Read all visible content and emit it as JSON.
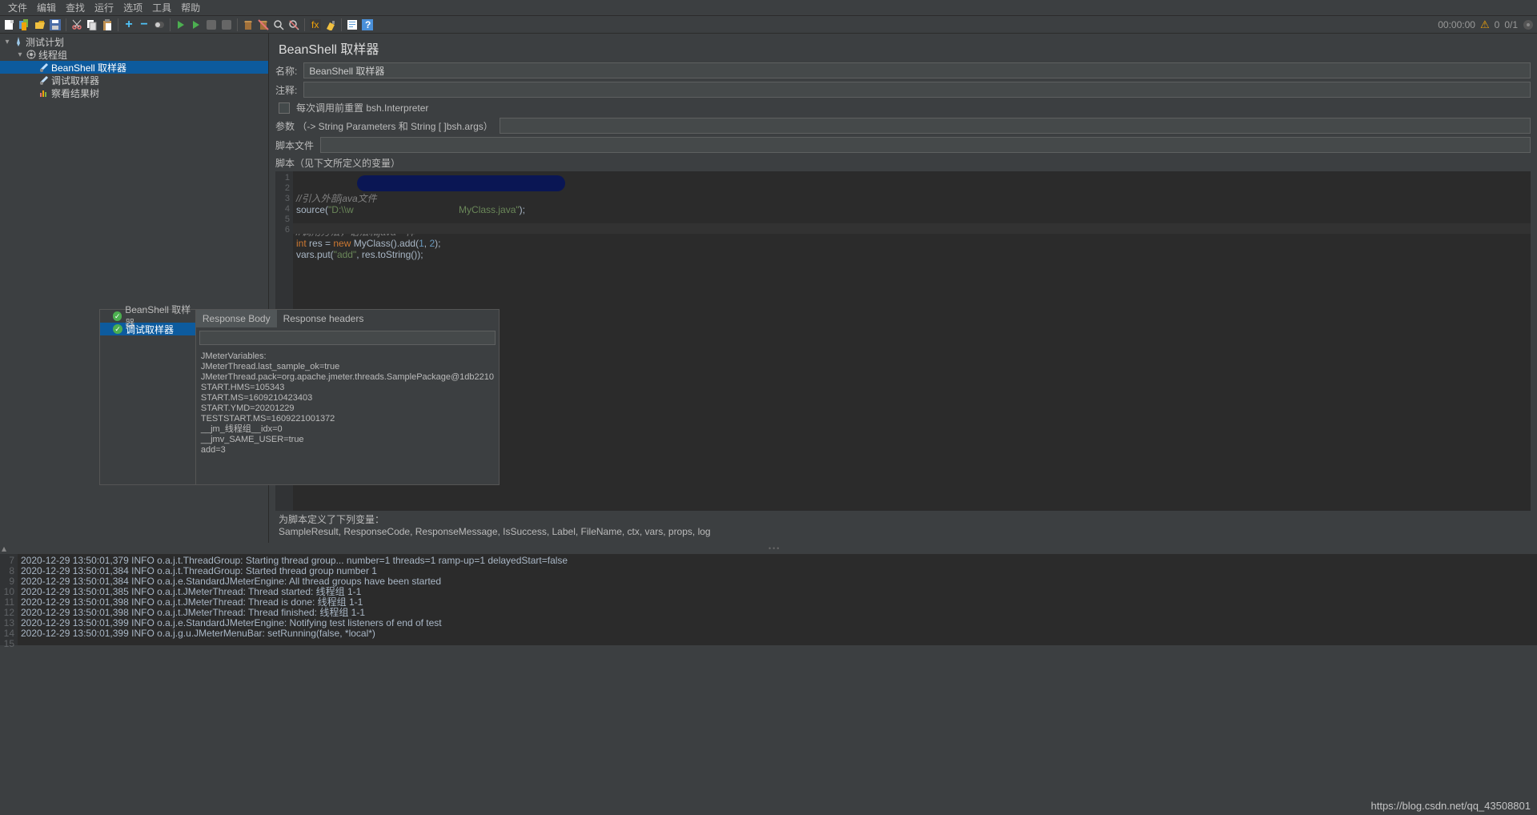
{
  "menu": [
    "文件",
    "编辑",
    "查找",
    "运行",
    "选项",
    "工具",
    "帮助"
  ],
  "status": {
    "time": "00:00:00",
    "warn_count": "0",
    "ratio": "0/1"
  },
  "tree": {
    "root": "测试计划",
    "group": "线程组",
    "items": [
      "BeanShell 取样器",
      "调试取样器",
      "察看结果树"
    ]
  },
  "panel": {
    "title": "BeanShell 取样器",
    "name_label": "名称:",
    "name_value": "BeanShell 取样器",
    "comment_label": "注释:",
    "reset_label": "每次调用前重置 bsh.Interpreter",
    "params_label": "参数 （-> String Parameters 和 String [ ]bsh.args）",
    "file_label": "脚本文件",
    "script_label": "脚本（见下文所定义的变量）"
  },
  "code_lines": {
    "l1": "//引入外部java文件",
    "l2a": "source(",
    "l2b": "\"D:\\\\w",
    "l2c": "MyClass.java\"",
    "l2d": ");",
    "l3": "",
    "l4": "//调用方法，语法和java一样",
    "l5a": "int",
    "l5b": " res = ",
    "l5c": "new",
    "l5d": " MyClass().add(",
    "l5e": "1",
    "l5f": ", ",
    "l5g": "2",
    "l5h": ");",
    "l6a": "vars.put(",
    "l6b": "\"add\"",
    "l6c": ", res.toString());"
  },
  "footer": {
    "l1": "为脚本定义了下列变量：",
    "l2": "SampleResult, ResponseCode, ResponseMessage, IsSuccess, Label, FileName, ctx, vars, props, log"
  },
  "popup": {
    "tree": [
      "BeanShell 取样器",
      "调试取样器"
    ],
    "tabs": [
      "Response Body",
      "Response headers"
    ],
    "body": "JMeterVariables:\nJMeterThread.last_sample_ok=true\nJMeterThread.pack=org.apache.jmeter.threads.SamplePackage@1db2210\nSTART.HMS=105343\nSTART.MS=1609210423403\nSTART.YMD=20201229\nTESTSTART.MS=1609221001372\n__jm_线程组__idx=0\n__jmv_SAME_USER=true\nadd=3"
  },
  "log_lines": [
    "2020-12-29 13:50:01,379 INFO o.a.j.t.ThreadGroup: Starting thread group... number=1 threads=1 ramp-up=1 delayedStart=false",
    "2020-12-29 13:50:01,384 INFO o.a.j.t.ThreadGroup: Started thread group number 1",
    "2020-12-29 13:50:01,384 INFO o.a.j.e.StandardJMeterEngine: All thread groups have been started",
    "2020-12-29 13:50:01,385 INFO o.a.j.t.JMeterThread: Thread started: 线程组 1-1",
    "2020-12-29 13:50:01,398 INFO o.a.j.t.JMeterThread: Thread is done: 线程组 1-1",
    "2020-12-29 13:50:01,398 INFO o.a.j.t.JMeterThread: Thread finished: 线程组 1-1",
    "2020-12-29 13:50:01,399 INFO o.a.j.e.StandardJMeterEngine: Notifying test listeners of end of test",
    "2020-12-29 13:50:01,399 INFO o.a.j.g.u.JMeterMenuBar: setRunning(false, *local*)",
    ""
  ],
  "watermark": "https://blog.csdn.net/qq_43508801"
}
